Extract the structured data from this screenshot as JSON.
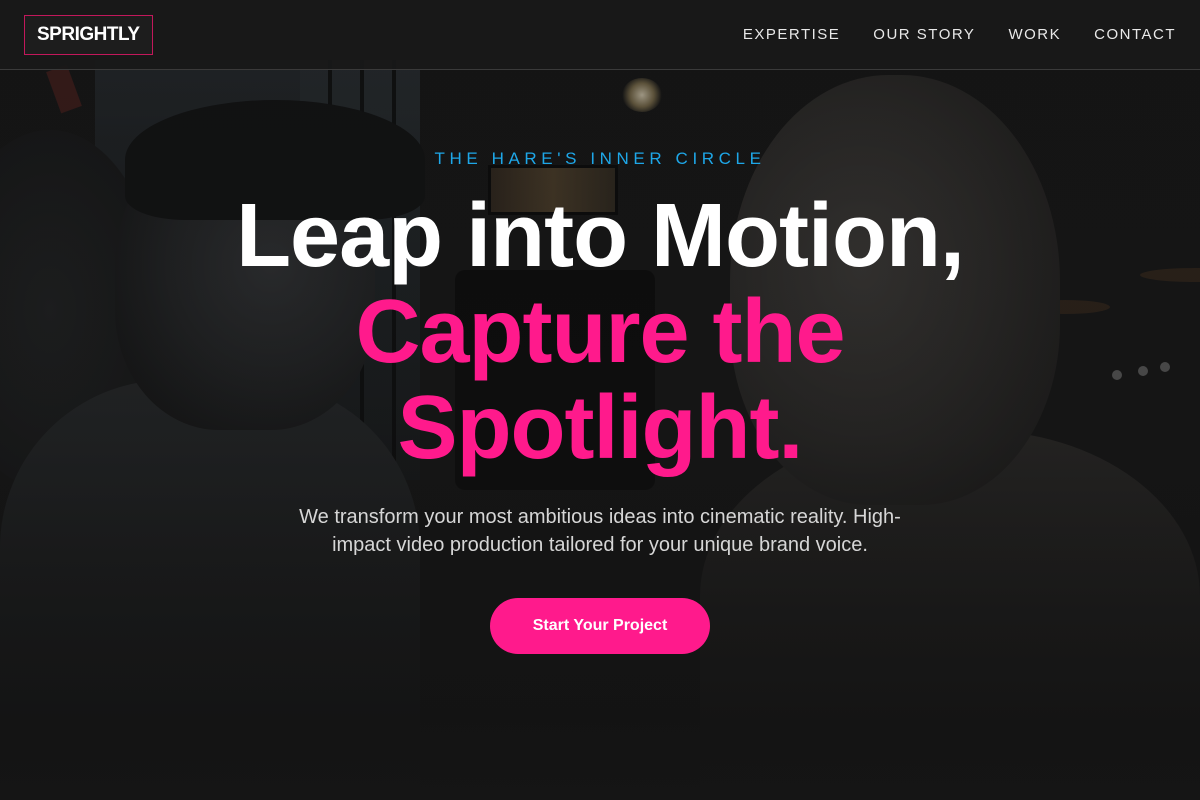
{
  "brand": {
    "logo_text": "SPRIGHTLY",
    "accent_color": "#ff1a8c",
    "eyebrow_color": "#1ea7e8"
  },
  "nav": {
    "items": [
      {
        "label": "EXPERTISE"
      },
      {
        "label": "OUR STORY"
      },
      {
        "label": "WORK"
      },
      {
        "label": "CONTACT"
      }
    ]
  },
  "hero": {
    "eyebrow": "THE HARE'S INNER CIRCLE",
    "headline_line1": "Leap into Motion,",
    "headline_line2": "Capture the",
    "headline_line3": "Spotlight.",
    "subtitle": "We transform your most ambitious ideas into cinematic reality. High-impact video production tailored for your unique brand voice.",
    "cta_label": "Start Your Project"
  }
}
